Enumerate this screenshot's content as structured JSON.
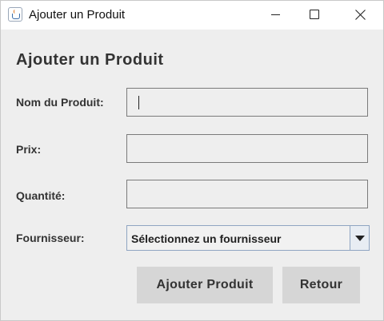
{
  "window": {
    "title": "Ajouter un Produit"
  },
  "form": {
    "heading": "Ajouter un Produit",
    "fields": [
      {
        "label": "Nom du Produit:",
        "value": ""
      },
      {
        "label": "Prix:",
        "value": ""
      },
      {
        "label": "Quantité:",
        "value": ""
      }
    ],
    "supplier": {
      "label": "Fournisseur:",
      "selected": "Sélectionnez un fournisseur"
    }
  },
  "buttons": {
    "add": "Ajouter Produit",
    "back": "Retour"
  },
  "icons": {
    "app": "java-app-icon",
    "minimize": "minimize-icon",
    "maximize": "maximize-icon",
    "close": "close-icon",
    "dropdown": "chevron-down-icon"
  }
}
